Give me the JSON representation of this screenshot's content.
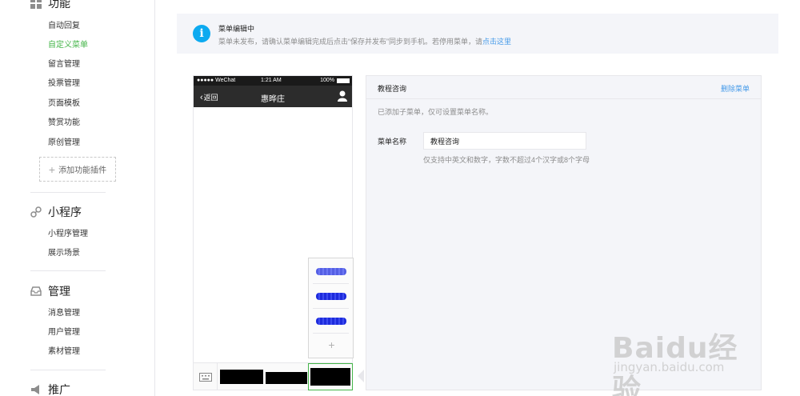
{
  "sidebar": {
    "section_function": "功能",
    "function_items": [
      "自动回复",
      "自定义菜单",
      "留言管理",
      "投票管理",
      "页面模板",
      "赞赏功能",
      "原创管理"
    ],
    "add_plugin": "添加功能插件",
    "section_miniprogram": "小程序",
    "miniprogram_items": [
      "小程序管理",
      "展示场景"
    ],
    "section_manage": "管理",
    "manage_items": [
      "消息管理",
      "用户管理",
      "素材管理"
    ],
    "section_promote": "推广",
    "accent_color": "#44b549"
  },
  "notice": {
    "title": "菜单编辑中",
    "desc": "菜单未发布，请确认菜单编辑完成后点击“保存并发布”同步到手机。若停用菜单，请",
    "link": "点击这里"
  },
  "phone": {
    "carrier": "●●●●● WeChat",
    "time": "1:21 AM",
    "battery": "100%",
    "back_label": "返回",
    "account_name": "惠晔庄",
    "submenu_plus": "+"
  },
  "editor": {
    "menu_title": "教程咨询",
    "delete_label": "删除菜单",
    "tip": "已添加子菜单，仅可设置菜单名称。",
    "name_label": "菜单名称",
    "name_value": "教程咨询",
    "name_hint": "仅支持中英文和数字，字数不超过4个汉字或8个字母"
  },
  "watermark": {
    "brand": "Baidu经验",
    "url": "jingyan.baidu.com"
  }
}
